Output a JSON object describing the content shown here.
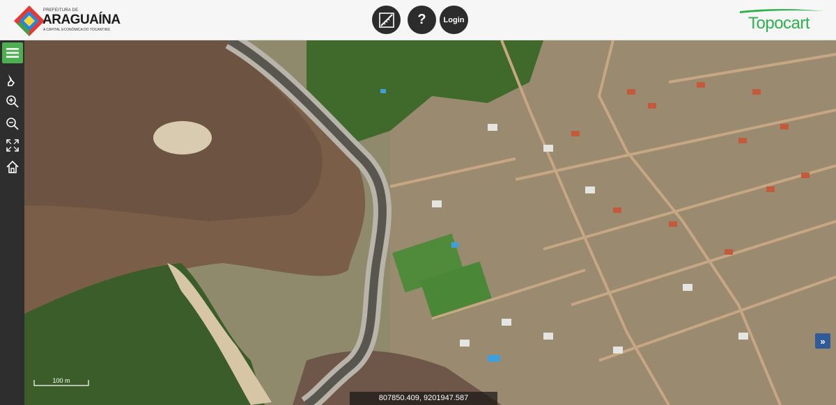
{
  "header": {
    "logo": {
      "top_line": "PREFEITURA DE",
      "city": "ARAGUAÍNA",
      "tagline": "A CAPITAL ECONÔMICA DO TOCANTINS"
    },
    "toolbar": {
      "measure_icon": "ruler-measure-icon",
      "help_label": "?",
      "login_label": "Login"
    },
    "brand": "Topocart"
  },
  "sidebar": {
    "items": [
      {
        "icon": "menu-icon"
      },
      {
        "icon": "brush-icon"
      },
      {
        "icon": "zoom-in-icon"
      },
      {
        "icon": "zoom-out-icon"
      },
      {
        "icon": "fullscreen-icon"
      },
      {
        "icon": "home-icon"
      }
    ]
  },
  "map": {
    "scale_label": "100 m",
    "coordinates": "807850.409, 9201947.587",
    "expand_label": "»"
  },
  "colors": {
    "accent": "#4caf50",
    "brand": "#2bb24c",
    "toolbar": "#2c2c2c",
    "water": "#7a5e48",
    "sidebar": "#2e2e2e"
  }
}
